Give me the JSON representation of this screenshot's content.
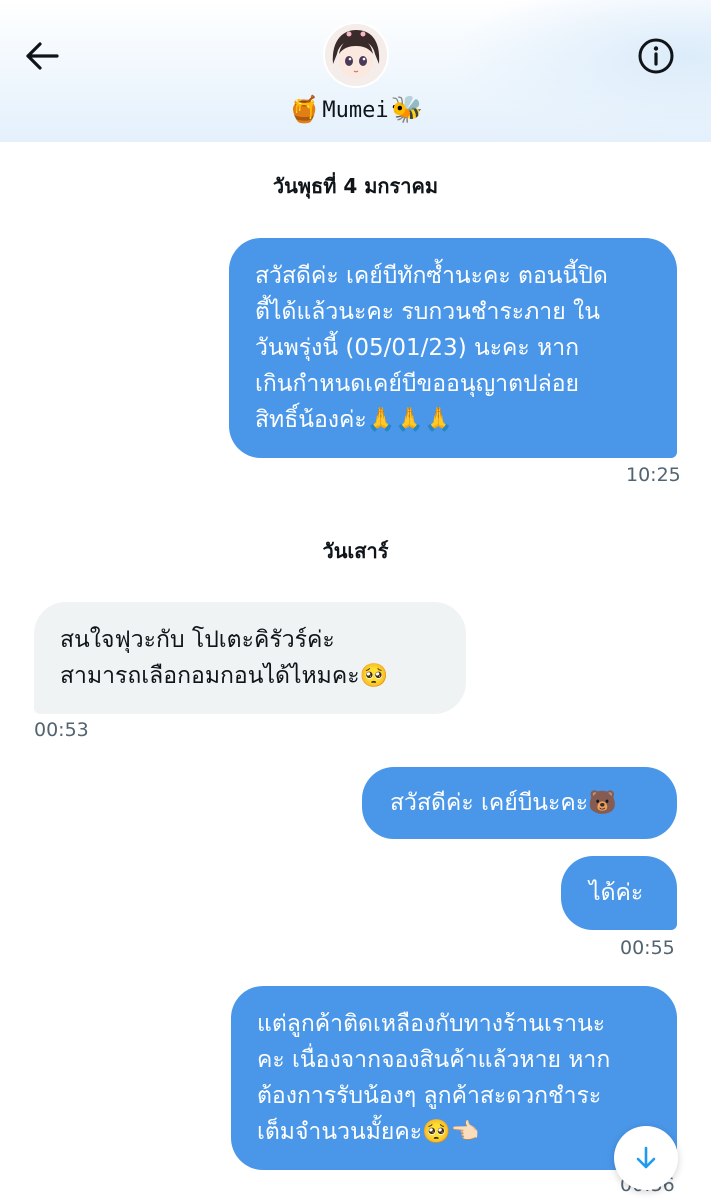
{
  "header": {
    "back_icon": "arrow-left-icon",
    "info_icon": "info-icon",
    "name": "Mumei",
    "name_prefix_emoji": "🍯",
    "name_suffix_emoji": "🐝"
  },
  "conversation": {
    "date_1": "วันพุธที่ 4 มกราคม",
    "date_2": "วันเสาร์",
    "messages": [
      {
        "direction": "sent",
        "text": "สวัสดีค่ะ เคย์บีทักซ้ำนะคะ ตอนนี้ปิด\nตี้ได้แล้วนะคะ รบกวนชำระภาย ใน\nวันพรุ่งนี้ (05/01/23)  นะคะ หาก\nเกินกำหนดเคย์บีขออนุญาตปล่อย\nสิทธิ์น้องค่ะ🙏🙏🙏",
        "time": "10:25"
      },
      {
        "direction": "received",
        "text": "สนใจฟุวะกับ โปเตะคิรัวร์ค่ะ\nสามารถเลือกอมกอนได้ไหมคะ🥺",
        "time": "00:53"
      },
      {
        "direction": "sent",
        "text": "สวัสดีค่ะ เคย์บีนะคะ🐻"
      },
      {
        "direction": "sent",
        "text": "ได้ค่ะ",
        "time": "00:55"
      },
      {
        "direction": "sent",
        "text": "แต่ลูกค้าติดเหลืองกับทางร้านเรานะ\nคะ เนื่องจากจองสินค้าแล้วหาย หาก\nต้องการรับน้องๆ ลูกค้าสะดวกชำระ\nเต็มจำนวนมั้ยคะ🥺👈🏻",
        "time": "00:56"
      }
    ]
  },
  "scroll_button": {
    "icon": "arrow-down-icon",
    "color": "#1d9bf0"
  },
  "colors": {
    "sent_bubble": "#4a97e9",
    "received_bubble": "#eff3f4",
    "timestamp": "#536471"
  }
}
